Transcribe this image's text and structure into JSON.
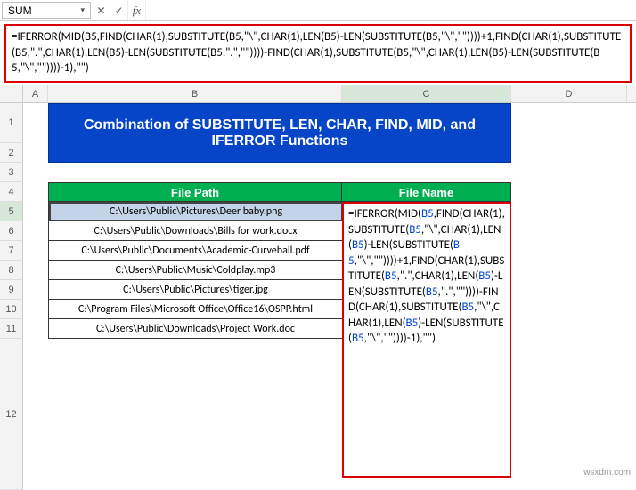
{
  "namebox": {
    "value": "SUM",
    "arrow": "▾"
  },
  "fx": {
    "cancel": "✕",
    "enter": "✓",
    "label": "fx"
  },
  "formula_bar": "=IFERROR(MID(B5,FIND(CHAR(1),SUBSTITUTE(B5,\"\\\",CHAR(1),LEN(B5)-LEN(SUBSTITUTE(B5,\"\\\",\"\"))))+1,FIND(CHAR(1),SUBSTITUTE(B5,\".\",CHAR(1),LEN(B5)-LEN(SUBSTITUTE(B5,\".\",\"\"))))-FIND(CHAR(1),SUBSTITUTE(B5,\"\\\",CHAR(1),LEN(B5)-LEN(SUBSTITUTE(B5,\"\\\",\"\"))))-1),\"\")",
  "columns": {
    "A": "A",
    "B": "B",
    "C": "C",
    "D": "D"
  },
  "rows": [
    "1",
    "2",
    "3",
    "4",
    "5",
    "6",
    "7",
    "8",
    "9",
    "10",
    "11",
    "12"
  ],
  "title": "Combination of SUBSTITUTE, LEN, CHAR, FIND, MID, and IFERROR Functions",
  "headers": {
    "path": "File Path",
    "name": "File Name"
  },
  "paths": [
    "C:\\Users\\Public\\Pictures\\Deer baby.png",
    "C:\\Users\\Public\\Downloads\\Bills for work.docx",
    "C:\\Users\\Public\\Documents\\Academic-Curveball.pdf",
    "C:\\Users\\Public\\Music\\Coldplay.mp3",
    "C:\\Users\\Public\\Pictures\\tiger.jpg",
    "C:\\Program Files\\Microsoft Office\\Office16\\OSPP.html",
    "C:\\Users\\Public\\Downloads\\Project Work.doc"
  ],
  "formula_cell_parts": [
    {
      "t": "=IFERROR(MID("
    },
    {
      "t": "B5",
      "c": "blue"
    },
    {
      "t": ",FIND("
    },
    {
      "t": "CHAR(1),SUBSTITUTE("
    },
    {
      "t": "B5",
      "c": "blue"
    },
    {
      "t": ","
    },
    {
      "t": "\"\\\",CHAR(1),LEN("
    },
    {
      "t": "B5",
      "c": "blue"
    },
    {
      "t": ")-LEN("
    },
    {
      "t": "SUBSTITUTE("
    },
    {
      "t": "B5",
      "c": "blue"
    },
    {
      "t": ",\"\\\",\"\"))))+1,"
    },
    {
      "t": "FIND(CHAR(1),"
    },
    {
      "t": "SUBSTITUTE("
    },
    {
      "t": "B5",
      "c": "blue"
    },
    {
      "t": ",\".\",CHAR("
    },
    {
      "t": "1),LEN("
    },
    {
      "t": "B5",
      "c": "blue"
    },
    {
      "t": ")-LEN("
    },
    {
      "t": "SUBSTITUTE("
    },
    {
      "t": "B5",
      "c": "blue"
    },
    {
      "t": ",\".\",\"\"))))-"
    },
    {
      "t": "FIND(CHAR(1),"
    },
    {
      "t": "SUBSTITUTE("
    },
    {
      "t": "B5",
      "c": "blue"
    },
    {
      "t": ",\"\\\",CHAR("
    },
    {
      "t": "1),LEN("
    },
    {
      "t": "B5",
      "c": "blue"
    },
    {
      "t": ")-LEN("
    },
    {
      "t": "SUBSTITUTE("
    },
    {
      "t": "B5",
      "c": "blue"
    },
    {
      "t": ",\"\\\",\"\"))))-1),"
    },
    {
      "t": "\"\")"
    }
  ],
  "watermark": "wsxdm.com"
}
